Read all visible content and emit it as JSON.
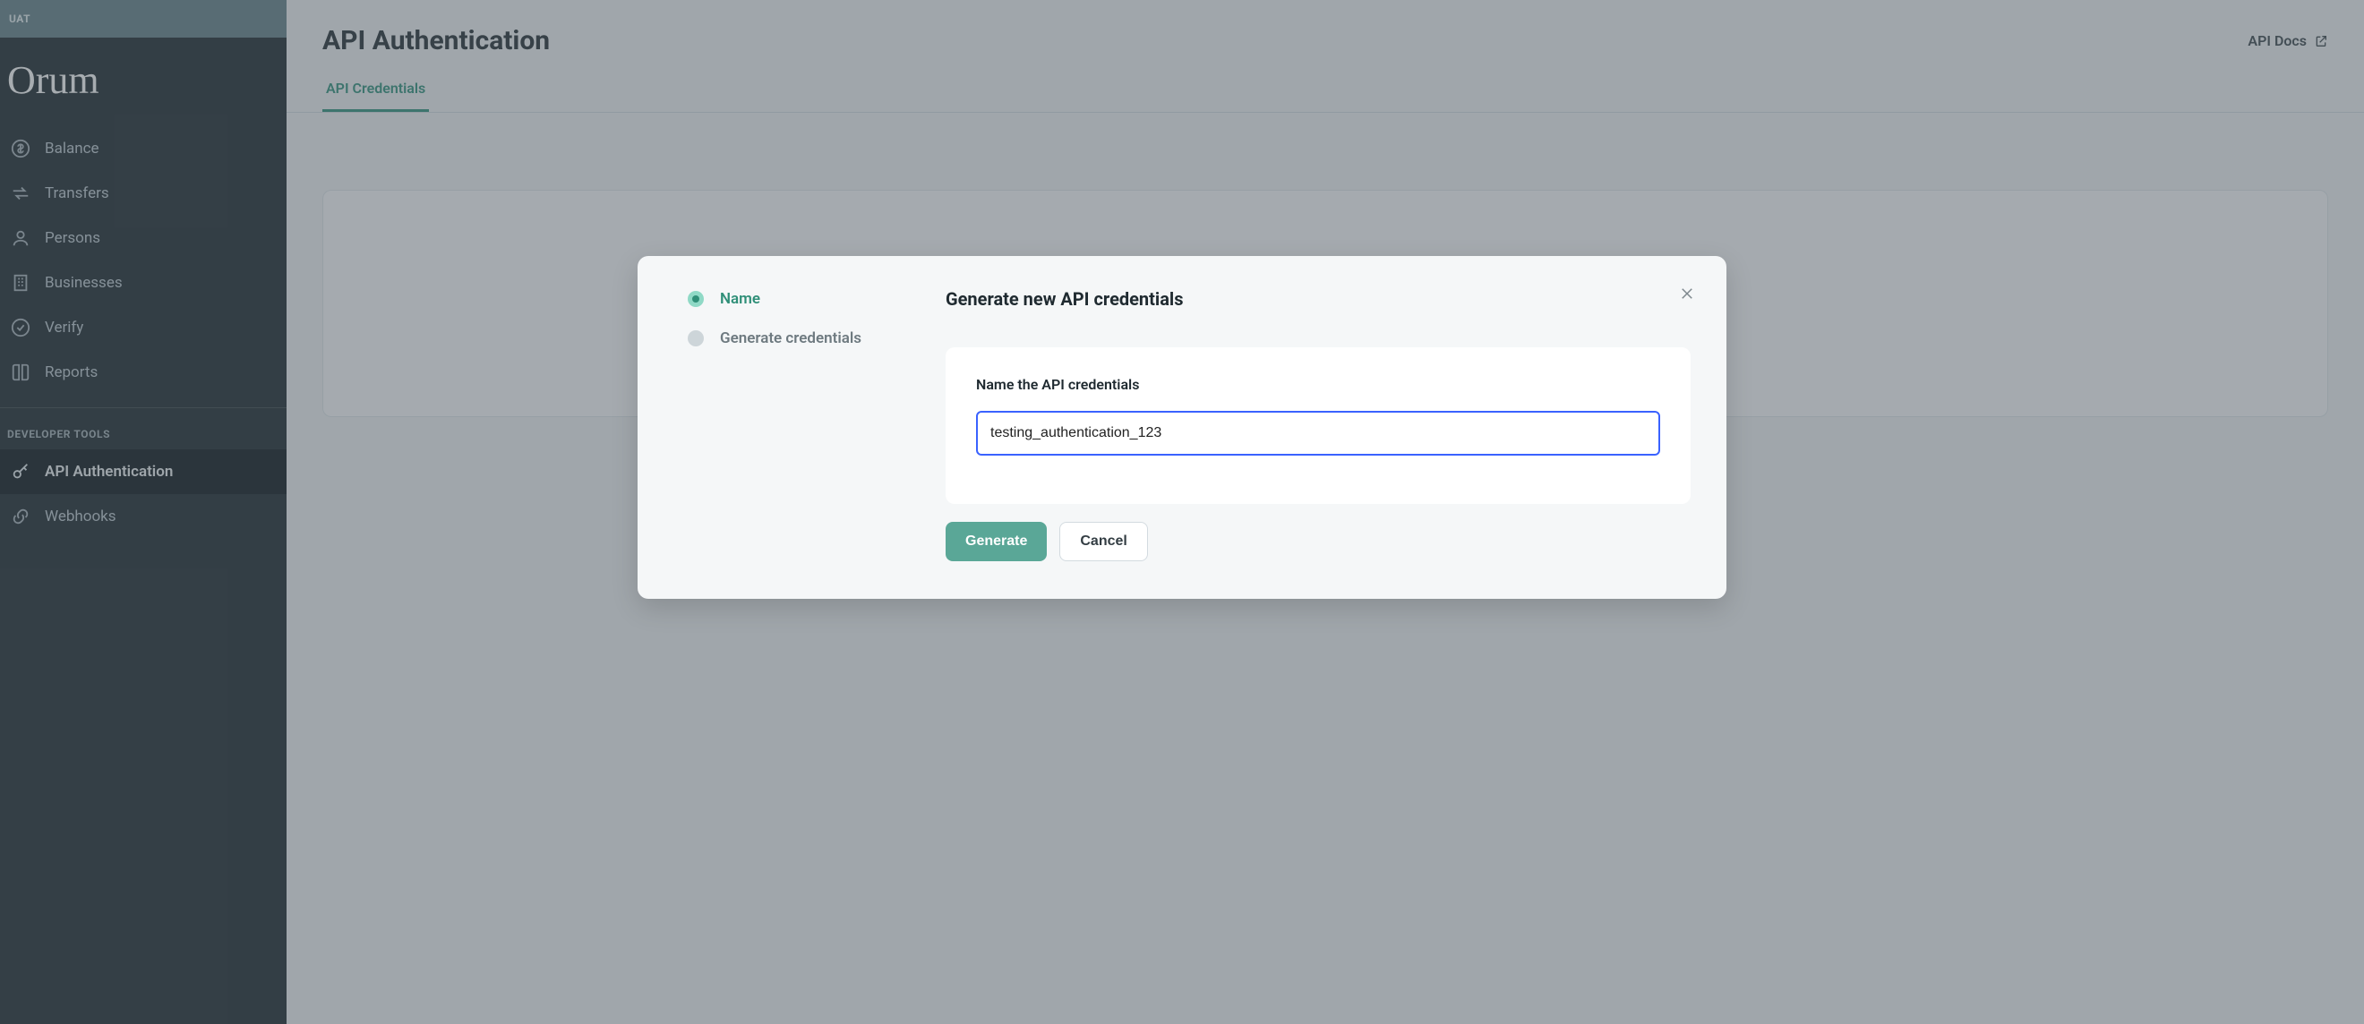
{
  "env_banner": "UAT",
  "brand": "Orum",
  "sidebar": {
    "items": [
      {
        "label": "Balance",
        "icon": "dollar-circle-icon"
      },
      {
        "label": "Transfers",
        "icon": "transfers-icon"
      },
      {
        "label": "Persons",
        "icon": "person-icon"
      },
      {
        "label": "Businesses",
        "icon": "building-icon"
      },
      {
        "label": "Verify",
        "icon": "check-circle-icon"
      },
      {
        "label": "Reports",
        "icon": "book-icon"
      }
    ],
    "dev_section_header": "DEVELOPER TOOLS",
    "dev_items": [
      {
        "label": "API Authentication",
        "icon": "key-icon",
        "active": true
      },
      {
        "label": "Webhooks",
        "icon": "link-icon"
      }
    ]
  },
  "page": {
    "title": "API Authentication",
    "docs_link": "API Docs",
    "tabs": [
      {
        "label": "API Credentials",
        "active": true
      }
    ]
  },
  "modal": {
    "title": "Generate new API credentials",
    "steps": [
      {
        "label": "Name",
        "active": true
      },
      {
        "label": "Generate credentials",
        "active": false
      }
    ],
    "field_label": "Name the API credentials",
    "input_value": "testing_authentication_123",
    "primary_button": "Generate",
    "secondary_button": "Cancel"
  }
}
